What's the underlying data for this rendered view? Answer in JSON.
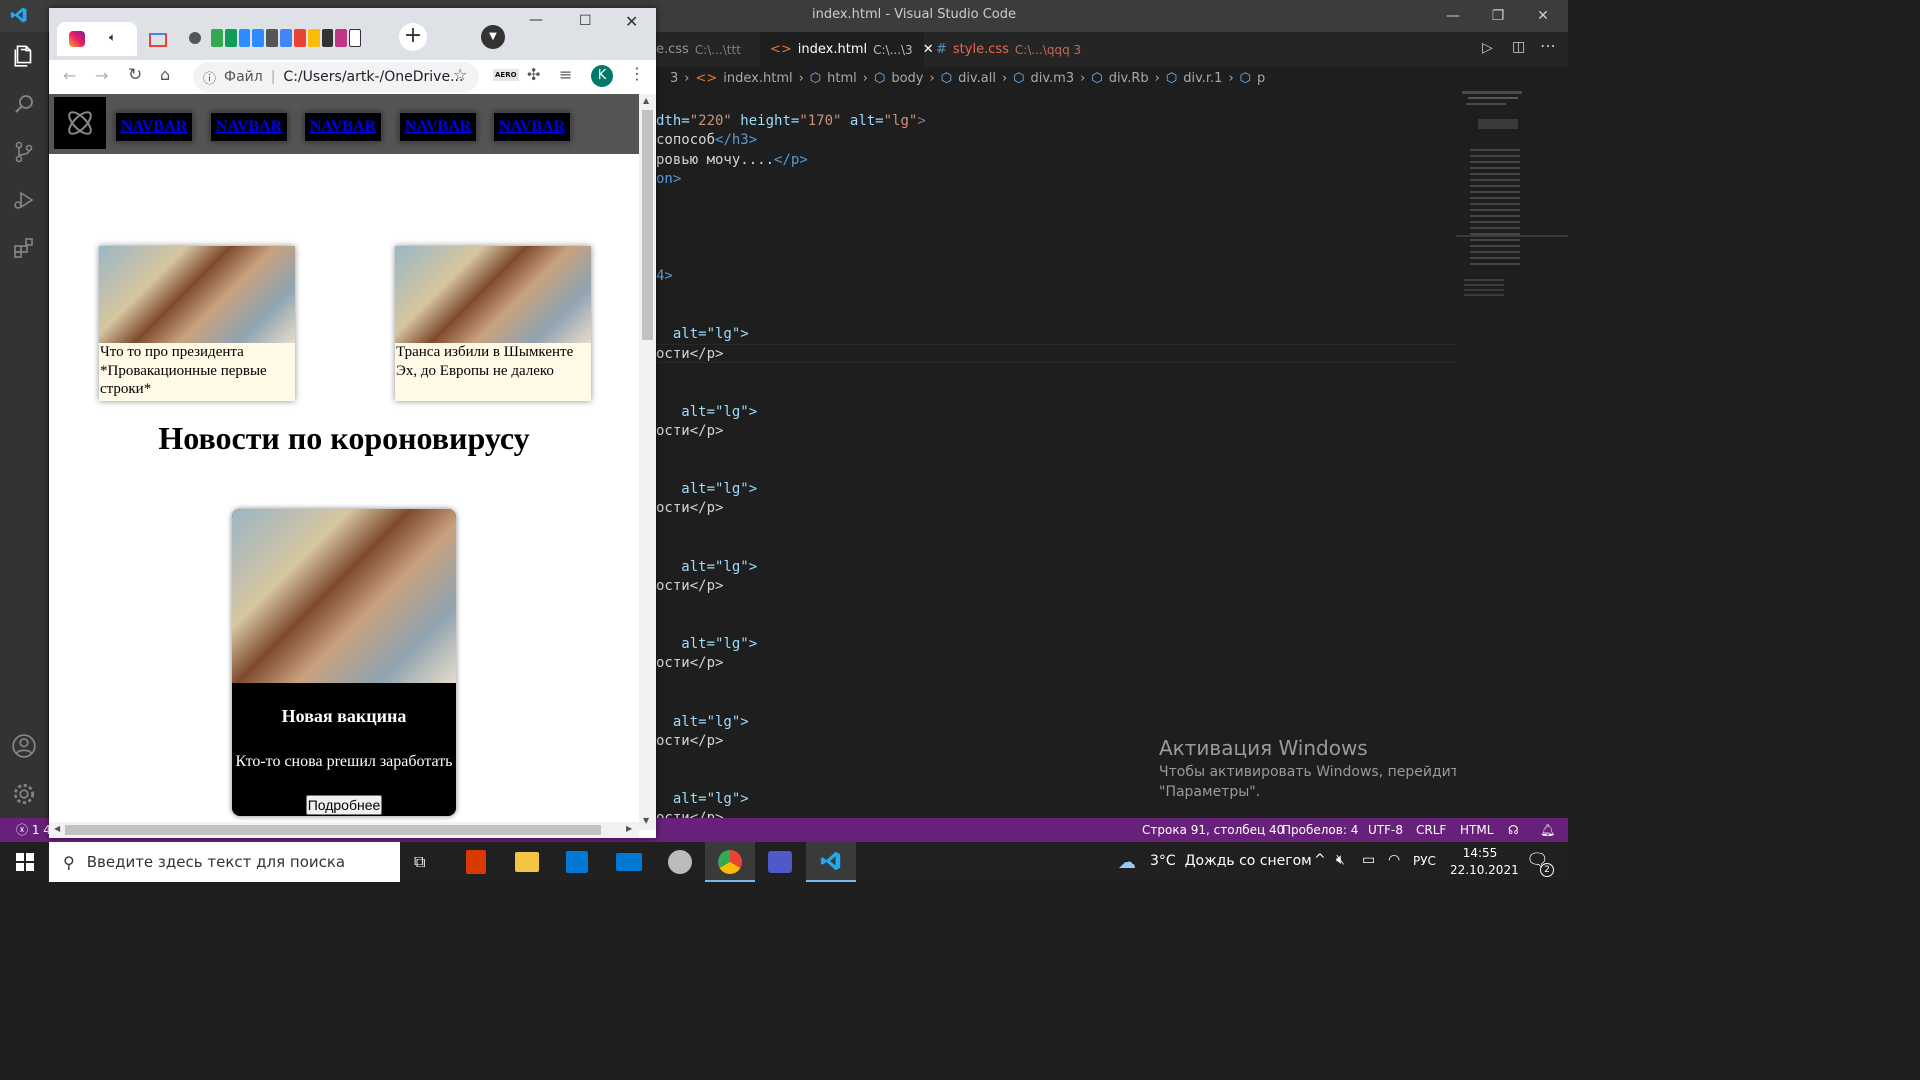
{
  "vscode": {
    "title": "index.html - Visual Studio Code",
    "tabs": [
      {
        "label": "e.css",
        "path": "C:\\...\\ttt",
        "active": false
      },
      {
        "label": "index.html",
        "path": "C:\\...\\3",
        "active": true
      },
      {
        "label": "style.css",
        "path": "C:\\...\\qqq 3",
        "active": false
      }
    ],
    "breadcrumb": [
      "3",
      "index.html",
      "html",
      "body",
      "div.all",
      "div.m3",
      "div.Rb",
      "div.r.1",
      "p"
    ],
    "code_lines": [
      {
        "a": "dth=",
        "b": "\"220\"",
        "c": " height=",
        "d": "\"170\"",
        "e": " alt=",
        "f": "\"lg\"",
        "g": ">"
      },
      {
        "text": "сопособ",
        "end": "</h3>"
      },
      {
        "text": "ровью мочу....",
        "end": "</p>"
      },
      {
        "text": "on>"
      },
      {
        "text": "4>"
      },
      {
        "text": "  alt=\"lg\">"
      },
      {
        "text": "ости</p>"
      },
      {
        "text": "   alt=\"lg\">"
      },
      {
        "text": "ости</p>"
      },
      {
        "text": "   alt=\"lg\">"
      },
      {
        "text": "ости</p>"
      },
      {
        "text": "   alt=\"lg\">"
      },
      {
        "text": "ости</p>"
      },
      {
        "text": "   alt=\"lg\">"
      },
      {
        "text": "ости</p>"
      },
      {
        "text": "  alt=\"lg\">"
      },
      {
        "text": "ости</p>"
      },
      {
        "text": "  alt=\"lg\">"
      },
      {
        "text": "ости</p>"
      }
    ],
    "status": {
      "errors": "1 4",
      "position": "Строка 91, столбец 40",
      "spaces": "Пробелов: 4",
      "encoding": "UTF-8",
      "eol": "CRLF",
      "language": "HTML"
    },
    "activation": {
      "title": "Активация Windows",
      "line1": "Чтобы активировать Windows, перейдите в раздел",
      "line2": "\"Параметры\"."
    }
  },
  "chrome": {
    "address_prefix": "Файл",
    "address": "C:/Users/artk-/OneDrive...",
    "profile_initial": "K",
    "ext_label": "AERO"
  },
  "page": {
    "nav": [
      "NAVBAR",
      "NAVBAR",
      "NAVBAR",
      "NAVBAR",
      "NAVBAR"
    ],
    "cards": [
      {
        "text": "Что то про президента *Провакационные первые строки*"
      },
      {
        "text": "Транса избили в Шымкенте Эх, до Европы не далеко"
      }
    ],
    "section_title": "Новости по короновирусу",
    "feature": {
      "title": "Новая вакцина",
      "text": "Кто-то снова рreшил заработать",
      "button": "Подробнее"
    }
  },
  "taskbar": {
    "search_placeholder": "Введите здесь текст для поиска",
    "weather": "3°C  Дождь со снегом",
    "lang": "РУС",
    "time": "14:55",
    "date": "22.10.2021",
    "notifications": "2"
  }
}
